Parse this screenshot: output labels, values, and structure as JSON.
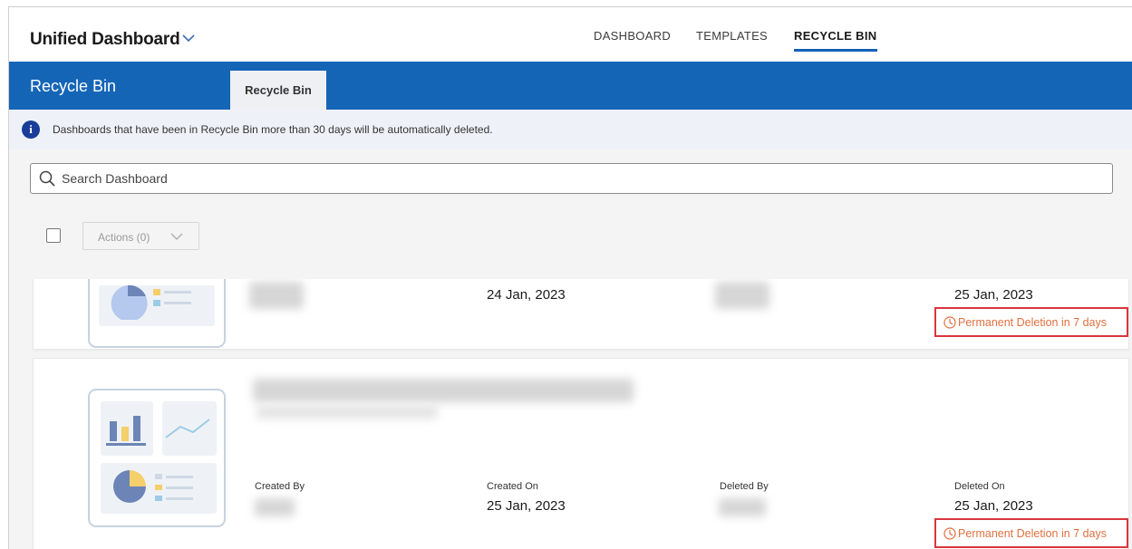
{
  "header": {
    "app_title": "Unified Dashboard",
    "nav": [
      {
        "label": "DASHBOARD",
        "active": false
      },
      {
        "label": "TEMPLATES",
        "active": false
      },
      {
        "label": "RECYCLE BIN",
        "active": true
      }
    ]
  },
  "page": {
    "title": "Recycle Bin",
    "tab_label": "Recycle Bin"
  },
  "notice": {
    "icon": "info-icon",
    "text": "Dashboards that have been in Recycle Bin more than 30 days will be automatically deleted."
  },
  "search": {
    "placeholder": "Search Dashboard",
    "value": ""
  },
  "toolbar": {
    "actions_label": "Actions (0)"
  },
  "columns": {
    "created_by": "Created By",
    "created_on": "Created On",
    "deleted_by": "Deleted By",
    "deleted_on": "Deleted On"
  },
  "items": [
    {
      "created_on": "24 Jan, 2023",
      "deleted_on": "25 Jan, 2023",
      "deletion_notice": "Permanent Deletion in 7 days"
    },
    {
      "created_on": "25 Jan, 2023",
      "deleted_on": "25 Jan, 2023",
      "deletion_notice": "Permanent Deletion in 7 days"
    }
  ],
  "colors": {
    "brand_blue": "#1565b7",
    "warning_text": "#e07040",
    "highlight_border": "#d9363e"
  }
}
